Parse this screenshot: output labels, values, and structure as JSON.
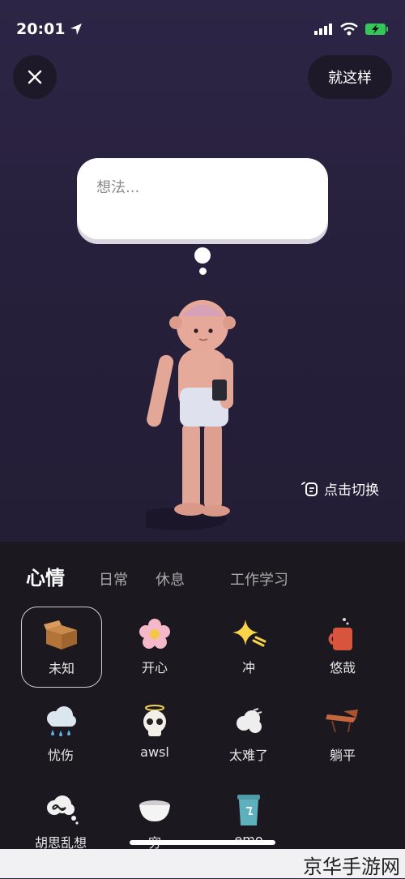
{
  "status": {
    "time": "20:01"
  },
  "header": {
    "done_label": "就这样"
  },
  "thought": {
    "placeholder": "想法..."
  },
  "switch_label": "点击切换",
  "tabs": [
    {
      "label": "心情"
    },
    {
      "label": "日常"
    },
    {
      "label": "休息"
    },
    {
      "label": "工作学习"
    }
  ],
  "moods": [
    {
      "label": "未知",
      "icon": "box-icon"
    },
    {
      "label": "开心",
      "icon": "flower-icon"
    },
    {
      "label": "冲",
      "icon": "sparkle-icon"
    },
    {
      "label": "悠哉",
      "icon": "mug-icon"
    },
    {
      "label": "忧伤",
      "icon": "rain-cloud-icon"
    },
    {
      "label": "awsl",
      "icon": "skull-icon"
    },
    {
      "label": "太难了",
      "icon": "puff-icon"
    },
    {
      "label": "躺平",
      "icon": "chair-icon"
    },
    {
      "label": "胡思乱想",
      "icon": "scribble-cloud-icon"
    },
    {
      "label": "穷",
      "icon": "empty-bowl-icon"
    },
    {
      "label": "emo",
      "icon": "trash-bin-icon"
    }
  ],
  "watermark": "京华手游网"
}
